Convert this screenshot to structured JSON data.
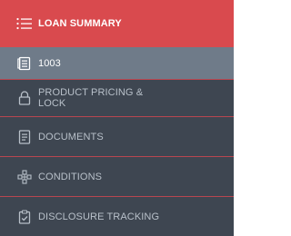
{
  "sidebar": {
    "header": {
      "label": "LOAN SUMMARY",
      "icon": "list-icon"
    },
    "items": [
      {
        "label": "1003",
        "icon": "form-icon",
        "active": true
      },
      {
        "label_line1": "PRODUCT PRICING &",
        "label_line2": "LOCK",
        "icon": "lock-icon"
      },
      {
        "label": "DOCUMENTS",
        "icon": "document-icon"
      },
      {
        "label": "CONDITIONS",
        "icon": "conditions-icon"
      },
      {
        "label": "DISCLOSURE TRACKING",
        "icon": "clipboard-check-icon"
      }
    ]
  },
  "colors": {
    "header_bg": "#d94a4e",
    "active_bg": "#6f7b89",
    "item_bg": "#3e4651",
    "divider": "#b84650"
  }
}
